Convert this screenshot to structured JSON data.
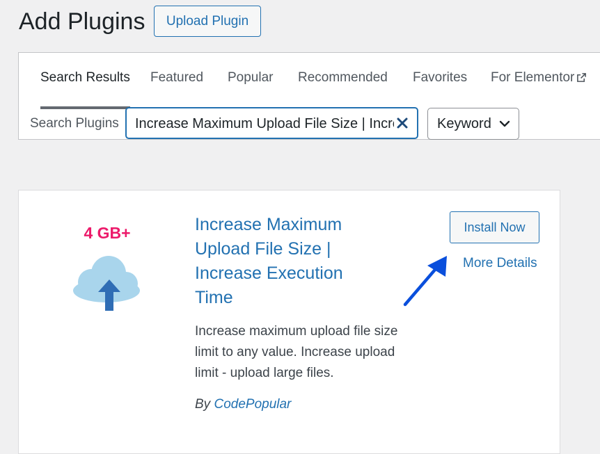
{
  "header": {
    "title": "Add Plugins",
    "upload_button": "Upload Plugin"
  },
  "tabs": [
    {
      "label": "Search Results",
      "active": true
    },
    {
      "label": "Featured"
    },
    {
      "label": "Popular"
    },
    {
      "label": "Recommended"
    },
    {
      "label": "Favorites"
    },
    {
      "label": "For Elementor",
      "icon": "external-link-icon"
    }
  ],
  "search": {
    "label": "Search Plugins",
    "value": "Increase Maximum Upload File Size | Increase Execution Time",
    "type_select": "Keyword"
  },
  "plugin": {
    "icon_text": "4 GB+",
    "icon": "cloud-upload-icon",
    "name": "Increase Maximum Upload File Size | Increase Execution Time",
    "description": "Increase maximum upload file size limit to any value. Increase upload limit - upload large files.",
    "author_prefix": "By",
    "author": "CodePopular",
    "install_button": "Install Now",
    "more_details": "More Details"
  },
  "colors": {
    "accent": "#2271b1",
    "icon_text": "#ec1a6a",
    "annotation_arrow": "#0a4fdc"
  }
}
